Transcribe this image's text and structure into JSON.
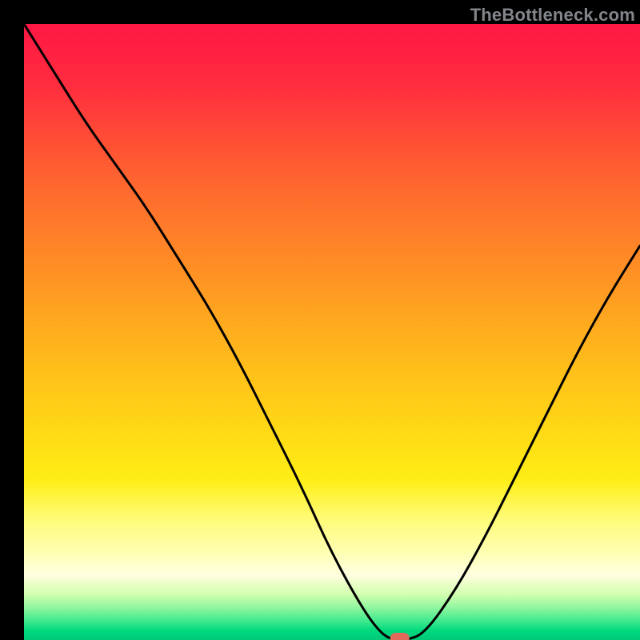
{
  "watermark": "TheBottleneck.com",
  "chart_data": {
    "type": "line",
    "title": "",
    "xlabel": "",
    "ylabel": "",
    "xlim": [
      0,
      100
    ],
    "ylim": [
      0,
      100
    ],
    "x": [
      0,
      5,
      10,
      15,
      20,
      25,
      30,
      35,
      40,
      45,
      50,
      55,
      58,
      60,
      62,
      65,
      70,
      75,
      80,
      85,
      90,
      95,
      100
    ],
    "y": [
      100,
      92,
      84,
      77,
      70,
      62,
      54,
      45,
      35,
      25,
      14,
      5,
      1,
      0,
      0,
      1,
      8,
      17,
      27,
      37,
      47,
      56,
      64
    ],
    "marker": {
      "x": 61,
      "y": 0,
      "color": "#e26a5a"
    },
    "background_gradient": {
      "top": "#ff1744",
      "mid": "#ffde15",
      "bottom": "#00c878"
    }
  }
}
